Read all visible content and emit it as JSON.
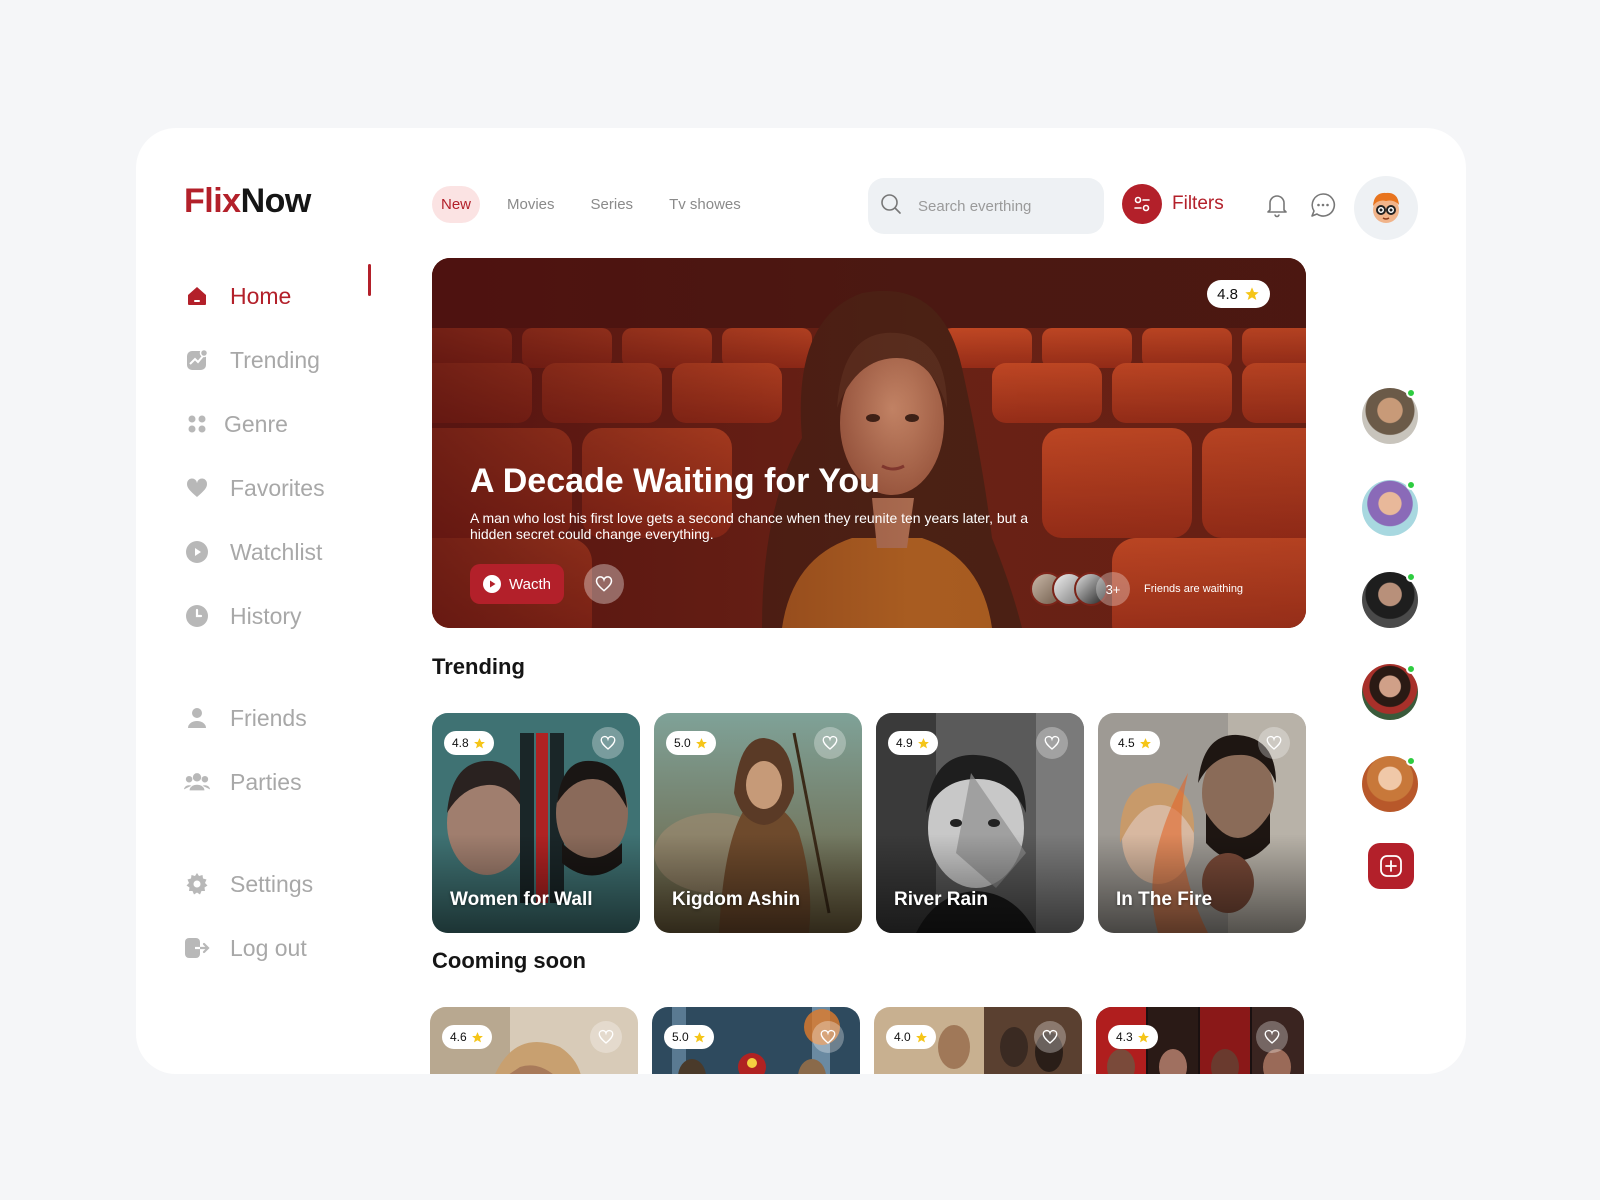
{
  "brand": {
    "part1": "Flix",
    "part2": "Now"
  },
  "sidebar": {
    "items": [
      {
        "label": "Home",
        "icon": "home-icon",
        "active": true
      },
      {
        "label": "Trending",
        "icon": "trending-icon"
      },
      {
        "label": "Genre",
        "icon": "grid-icon"
      },
      {
        "label": "Favorites",
        "icon": "heart-icon"
      },
      {
        "label": "Watchlist",
        "icon": "play-icon"
      },
      {
        "label": "History",
        "icon": "clock-icon"
      },
      {
        "label": "Friends",
        "icon": "user-icon"
      },
      {
        "label": "Parties",
        "icon": "group-icon"
      },
      {
        "label": "Settings",
        "icon": "gear-icon"
      },
      {
        "label": "Log out",
        "icon": "logout-icon"
      }
    ]
  },
  "header": {
    "tabs": [
      {
        "label": "New",
        "active": true
      },
      {
        "label": "Movies"
      },
      {
        "label": "Series"
      },
      {
        "label": "Tv showes"
      }
    ],
    "search_placeholder": "Search everthing",
    "filters_label": "Filters"
  },
  "hero": {
    "rating": "4.8",
    "title": "A Decade Waiting for You",
    "description": "A man who lost his first love gets a second chance when they reunite ten years later, but a hidden secret could change everything.",
    "watch_label": "Wacth",
    "friends_more": "3+",
    "friends_label": "Friends are waithing"
  },
  "trending": {
    "title": "Trending",
    "cards": [
      {
        "title": "Women for Wall",
        "rating": "4.8"
      },
      {
        "title": "Kigdom Ashin",
        "rating": "5.0"
      },
      {
        "title": "River Rain",
        "rating": "4.9"
      },
      {
        "title": "In The Fire",
        "rating": "4.5"
      }
    ]
  },
  "coming_soon": {
    "title": "Cooming soon",
    "cards": [
      {
        "rating": "4.6"
      },
      {
        "rating": "5.0"
      },
      {
        "rating": "4.0"
      },
      {
        "rating": "4.3"
      }
    ]
  },
  "colors": {
    "accent": "#b3202a",
    "online": "#2ecc40",
    "star": "#f5c518"
  }
}
